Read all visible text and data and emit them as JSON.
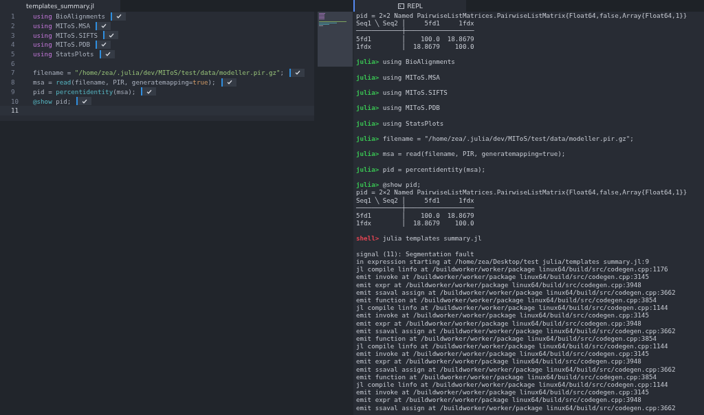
{
  "editor": {
    "tab": {
      "title": "templates_summary.jl",
      "selected": true
    },
    "lines": [
      {
        "number": "1",
        "evaluated": true,
        "current": false,
        "tokens": [
          {
            "kind": "keyword",
            "text": "using"
          },
          {
            "kind": "plain",
            "text": " BioAlignments"
          }
        ]
      },
      {
        "number": "2",
        "evaluated": true,
        "current": false,
        "tokens": [
          {
            "kind": "keyword",
            "text": "using"
          },
          {
            "kind": "plain",
            "text": " MIToS.MSA"
          }
        ]
      },
      {
        "number": "3",
        "evaluated": true,
        "current": false,
        "tokens": [
          {
            "kind": "keyword",
            "text": "using"
          },
          {
            "kind": "plain",
            "text": " MIToS.SIFTS"
          }
        ]
      },
      {
        "number": "4",
        "evaluated": true,
        "current": false,
        "tokens": [
          {
            "kind": "keyword",
            "text": "using"
          },
          {
            "kind": "plain",
            "text": " MIToS.PDB"
          }
        ]
      },
      {
        "number": "5",
        "evaluated": true,
        "current": false,
        "tokens": [
          {
            "kind": "keyword",
            "text": "using"
          },
          {
            "kind": "plain",
            "text": " StatsPlots"
          }
        ]
      },
      {
        "number": "6",
        "evaluated": false,
        "current": false
      },
      {
        "number": "7",
        "evaluated": true,
        "current": false,
        "tokens": [
          {
            "kind": "plain",
            "text": "filename = "
          },
          {
            "kind": "string",
            "text": "\"/home/zea/.julia/dev/MIToS/test/data/modeller.pir.gz\""
          },
          {
            "kind": "plain",
            "text": ";"
          }
        ]
      },
      {
        "number": "8",
        "evaluated": true,
        "current": false,
        "tokens": [
          {
            "kind": "plain",
            "text": "msa = "
          },
          {
            "kind": "function",
            "text": "read"
          },
          {
            "kind": "plain",
            "text": "(filename, PIR, generatemapping="
          },
          {
            "kind": "bool",
            "text": "true"
          },
          {
            "kind": "plain",
            "text": ");"
          }
        ]
      },
      {
        "number": "9",
        "evaluated": true,
        "current": false,
        "tokens": [
          {
            "kind": "plain",
            "text": "pid = "
          },
          {
            "kind": "function",
            "text": "percentidentity"
          },
          {
            "kind": "plain",
            "text": "(msa);"
          }
        ]
      },
      {
        "number": "10",
        "evaluated": true,
        "current": false,
        "tokens": [
          {
            "kind": "macro",
            "text": "@show"
          },
          {
            "kind": "plain",
            "text": " pid;"
          }
        ]
      },
      {
        "number": "11",
        "evaluated": false,
        "current": true
      }
    ]
  },
  "repl": {
    "tab": {
      "title": "REPL",
      "selected": true
    },
    "lines": [
      {
        "kind": "output",
        "text": "pid = 2×2 Named PairwiseListMatrices.PairwiseListMatrix{Float64,false,Array{Float64,1}}"
      },
      {
        "kind": "output",
        "text": "Seq1 ╲ Seq2 │     5fd1     1fdx"
      },
      {
        "kind": "output",
        "text": "────────────┼──────────────────"
      },
      {
        "kind": "output",
        "text": "5fd1        │    100.0  18.8679"
      },
      {
        "kind": "output",
        "text": "1fdx        │  18.8679    100.0"
      },
      {
        "kind": "blank"
      },
      {
        "kind": "julia_prompt",
        "prompt": "julia>",
        "text": "using BioAlignments"
      },
      {
        "kind": "blank"
      },
      {
        "kind": "julia_prompt",
        "prompt": "julia>",
        "text": "using MIToS.MSA"
      },
      {
        "kind": "blank"
      },
      {
        "kind": "julia_prompt",
        "prompt": "julia>",
        "text": "using MIToS.SIFTS"
      },
      {
        "kind": "blank"
      },
      {
        "kind": "julia_prompt",
        "prompt": "julia>",
        "text": "using MIToS.PDB"
      },
      {
        "kind": "blank"
      },
      {
        "kind": "julia_prompt",
        "prompt": "julia>",
        "text": "using StatsPlots"
      },
      {
        "kind": "blank"
      },
      {
        "kind": "julia_prompt",
        "prompt": "julia>",
        "text": "filename = \"/home/zea/.julia/dev/MIToS/test/data/modeller.pir.gz\";"
      },
      {
        "kind": "blank"
      },
      {
        "kind": "julia_prompt",
        "prompt": "julia>",
        "text": "msa = read(filename, PIR, generatemapping=true);"
      },
      {
        "kind": "blank"
      },
      {
        "kind": "julia_prompt",
        "prompt": "julia>",
        "text": "pid = percentidentity(msa);"
      },
      {
        "kind": "blank"
      },
      {
        "kind": "julia_prompt",
        "prompt": "julia>",
        "text": "@show pid;"
      },
      {
        "kind": "output",
        "text": "pid = 2×2 Named PairwiseListMatrices.PairwiseListMatrix{Float64,false,Array{Float64,1}}"
      },
      {
        "kind": "output",
        "text": "Seq1 ╲ Seq2 │     5fd1     1fdx"
      },
      {
        "kind": "output",
        "text": "────────────┼──────────────────"
      },
      {
        "kind": "output",
        "text": "5fd1        │    100.0  18.8679"
      },
      {
        "kind": "output",
        "text": "1fdx        │  18.8679    100.0"
      },
      {
        "kind": "blank"
      },
      {
        "kind": "shell_prompt",
        "prompt": "shell>",
        "text": "julia templates summary.jl"
      },
      {
        "kind": "blank"
      },
      {
        "kind": "output",
        "text": "signal (11): Segmentation fault"
      },
      {
        "kind": "output",
        "text": "in expression starting at /home/zea/Desktop/test julia/templates summary.jl:9"
      },
      {
        "kind": "output",
        "text": "jl compile linfo at /buildworker/worker/package linux64/build/src/codegen.cpp:1176"
      },
      {
        "kind": "output",
        "text": "emit invoke at /buildworker/worker/package linux64/build/src/codegen.cpp:3145"
      },
      {
        "kind": "output",
        "text": "emit expr at /buildworker/worker/package linux64/build/src/codegen.cpp:3948"
      },
      {
        "kind": "output",
        "text": "emit ssaval assign at /buildworker/worker/package linux64/build/src/codegen.cpp:3662"
      },
      {
        "kind": "output",
        "text": "emit function at /buildworker/worker/package linux64/build/src/codegen.cpp:3854"
      },
      {
        "kind": "output",
        "text": "jl compile linfo at /buildworker/worker/package linux64/build/src/codegen.cpp:1144"
      },
      {
        "kind": "output",
        "text": "emit invoke at /buildworker/worker/package linux64/build/src/codegen.cpp:3145"
      },
      {
        "kind": "output",
        "text": "emit expr at /buildworker/worker/package linux64/build/src/codegen.cpp:3948"
      },
      {
        "kind": "output",
        "text": "emit ssaval assign at /buildworker/worker/package linux64/build/src/codegen.cpp:3662"
      },
      {
        "kind": "output",
        "text": "emit function at /buildworker/worker/package linux64/build/src/codegen.cpp:3854"
      },
      {
        "kind": "output",
        "text": "jl compile linfo at /buildworker/worker/package linux64/build/src/codegen.cpp:1144"
      },
      {
        "kind": "output",
        "text": "emit invoke at /buildworker/worker/package linux64/build/src/codegen.cpp:3145"
      },
      {
        "kind": "output",
        "text": "emit expr at /buildworker/worker/package linux64/build/src/codegen.cpp:3948"
      },
      {
        "kind": "output",
        "text": "emit ssaval assign at /buildworker/worker/package linux64/build/src/codegen.cpp:3662"
      },
      {
        "kind": "output",
        "text": "emit function at /buildworker/worker/package linux64/build/src/codegen.cpp:3854"
      },
      {
        "kind": "output",
        "text": "jl compile linfo at /buildworker/worker/package linux64/build/src/codegen.cpp:1144"
      },
      {
        "kind": "output",
        "text": "emit invoke at /buildworker/worker/package linux64/build/src/codegen.cpp:3145"
      },
      {
        "kind": "output",
        "text": "emit expr at /buildworker/worker/package linux64/build/src/codegen.cpp:3948"
      },
      {
        "kind": "output",
        "text": "emit ssaval assign at /buildworker/worker/package linux64/build/src/codegen.cpp:3662"
      }
    ]
  }
}
